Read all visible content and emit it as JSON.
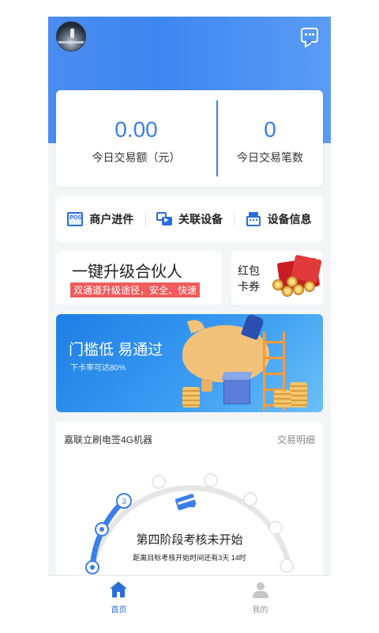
{
  "stats": {
    "amount_value": "0.00",
    "amount_label": "今日交易额（元）",
    "count_value": "0",
    "count_label": "今日交易笔数"
  },
  "shortcuts": [
    {
      "label": "商户进件",
      "icon": "pos-icon"
    },
    {
      "label": "关联设备",
      "icon": "link-device-icon"
    },
    {
      "label": "设备信息",
      "icon": "device-info-icon"
    }
  ],
  "promo": {
    "title": "一键升级合伙人",
    "tag": "双通道升级途径，安全、快速"
  },
  "redpack": {
    "line1": "红包",
    "line2": "卡券"
  },
  "banner": {
    "headline": "门槛低  易通过",
    "sub": "下卡率可达80%"
  },
  "task": {
    "device_name": "嘉联立刷电签4G机器",
    "detail_link": "交易明细",
    "current_step_label": "3",
    "stage_title": "第四阶段考核未开始",
    "stage_sub": "距离目标考核开始时间还有3天 14时",
    "colors": {
      "done": "#3b7fe8",
      "pending": "#e3e3e3"
    }
  },
  "tabbar": [
    {
      "label": "首页",
      "active": true,
      "icon": "home-icon"
    },
    {
      "label": "我的",
      "active": false,
      "icon": "user-icon"
    }
  ],
  "theme": {
    "primary": "#3b7fe8",
    "accent_red": "#f05b5b"
  }
}
